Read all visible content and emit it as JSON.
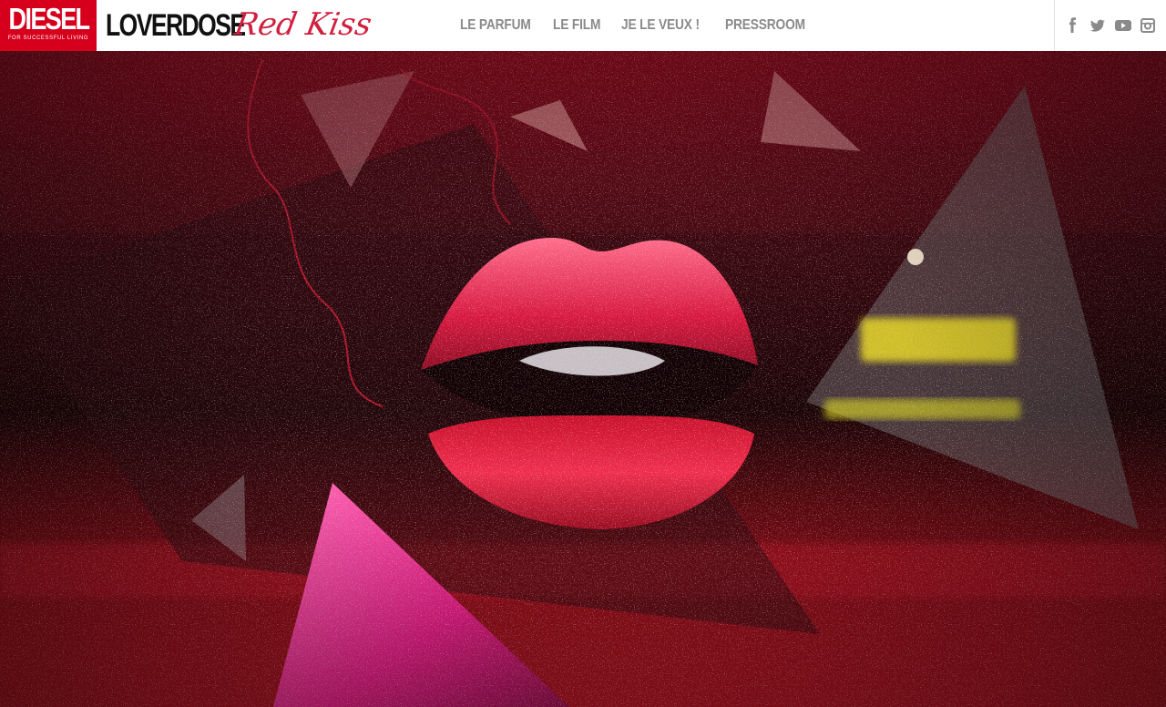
{
  "header": {
    "diesel_logo": {
      "word": "DIESEL",
      "tagline": "FOR SUCCESSFUL LIVING"
    },
    "brand": {
      "main": "LOVERDOSE",
      "script": "Red Kiss"
    },
    "nav": [
      {
        "label": "LE PARFUM"
      },
      {
        "label": "LE FILM"
      },
      {
        "label": "JE LE VEUX !"
      },
      {
        "label": "PRESSROOM"
      }
    ],
    "social": [
      "facebook-icon",
      "twitter-icon",
      "youtube-icon",
      "instagram-icon"
    ]
  },
  "colors": {
    "diesel_red": "#d6001c",
    "script_red": "#d1203f",
    "nav_gray": "#8a8a8a",
    "hero_red": "#8a0a1e"
  }
}
